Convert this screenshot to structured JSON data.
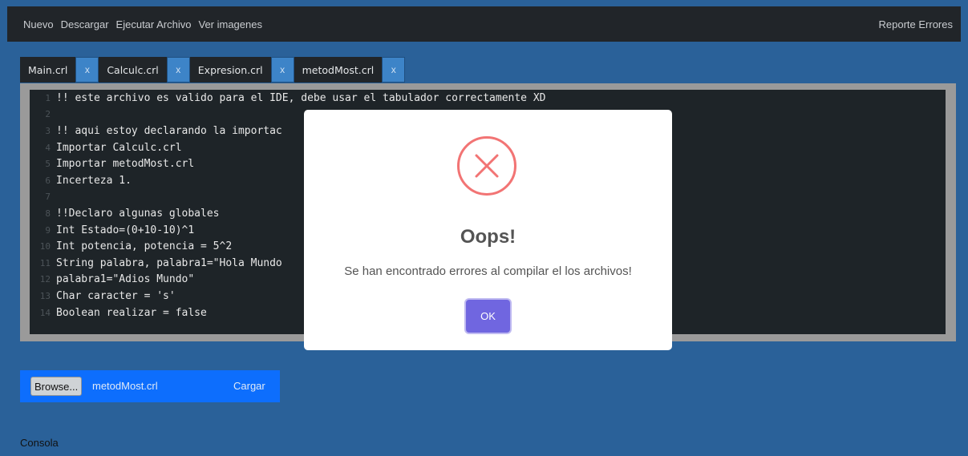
{
  "navbar": {
    "links": [
      "Nuevo",
      "Descargar",
      "Ejecutar Archivo",
      "Ver imagenes"
    ],
    "right": "Reporte Errores"
  },
  "tabs": [
    {
      "label": "Main.crl",
      "close": "x"
    },
    {
      "label": "Calculc.crl",
      "close": "x"
    },
    {
      "label": "Expresion.crl",
      "close": "x"
    },
    {
      "label": "metodMost.crl",
      "close": "x"
    }
  ],
  "editor": {
    "lines": [
      {
        "n": "1",
        "text": "!! este archivo es valido para el IDE, debe usar el tabulador correctamente XD"
      },
      {
        "n": "2",
        "text": ""
      },
      {
        "n": "3",
        "text": "!! aqui estoy declarando la importac"
      },
      {
        "n": "4",
        "text": "Importar Calculc.crl"
      },
      {
        "n": "5",
        "text": "Importar metodMost.crl"
      },
      {
        "n": "6",
        "text": "Incerteza 1."
      },
      {
        "n": "7",
        "text": ""
      },
      {
        "n": "8",
        "text": "!!Declaro algunas globales"
      },
      {
        "n": "9",
        "text": "Int Estado=(0+10-10)^1"
      },
      {
        "n": "10",
        "text": "Int potencia, potencia = 5^2"
      },
      {
        "n": "11",
        "text": "String palabra, palabra1=\"Hola Mundo"
      },
      {
        "n": "12",
        "text": "palabra1=\"Adios Mundo\""
      },
      {
        "n": "13",
        "text": "Char caracter = 's'"
      },
      {
        "n": "14",
        "text": "Boolean realizar = false"
      }
    ]
  },
  "modal": {
    "icon": "error-x-icon",
    "title": "Oops!",
    "text": "Se han encontrado errores al compilar el los archivos!",
    "ok": "OK"
  },
  "upload": {
    "browse": "Browse...",
    "file_name": "metodMost.crl",
    "load": "Cargar"
  },
  "console": {
    "label": "Consola"
  },
  "colors": {
    "background": "#2a6199",
    "navbar": "#212529",
    "editor": "#1e2428",
    "ok_button": "#7066e0",
    "error_icon": "#f27474"
  }
}
